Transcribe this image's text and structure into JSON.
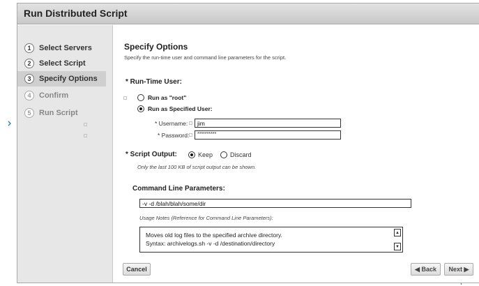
{
  "window": {
    "title": "Run Distributed Script"
  },
  "sidebar": {
    "steps": [
      {
        "number": "1",
        "label": "Select Servers"
      },
      {
        "number": "2",
        "label": "Select Script"
      },
      {
        "number": "3",
        "label": "Specify Options"
      },
      {
        "number": "4",
        "label": "Confirm"
      },
      {
        "number": "5",
        "label": "Run Script"
      }
    ]
  },
  "main": {
    "heading": "Specify Options",
    "subtitle": "Specify the run-time user and command line parameters for the script.",
    "runtime_user": {
      "section_label": "* Run-Time User:",
      "option_root": "Run as \"root\"",
      "option_specified": "Run as Specified User:",
      "username_label": "* Username:",
      "username_value": "jim",
      "password_label": "* Password:",
      "password_value": "**********"
    },
    "script_output": {
      "label": "* Script Output:",
      "option_keep": "Keep",
      "option_discard": "Discard",
      "note": "Only the last 100 KB of script output can be shown."
    },
    "command_line": {
      "section_label": "Command Line Parameters:",
      "value": "-v -d /blah/blah/some/dir",
      "usage_label": "Usage Notes (Reference for Command Line Parameters):",
      "usage_line1": "Moves old log files to the specified archive directory.",
      "usage_line2": "Syntax: archivelogs.sh -v -d /destination/directory"
    }
  },
  "footer": {
    "cancel_label": "Cancel",
    "back_label": "◀ Back",
    "next_label": "Next ▶"
  }
}
